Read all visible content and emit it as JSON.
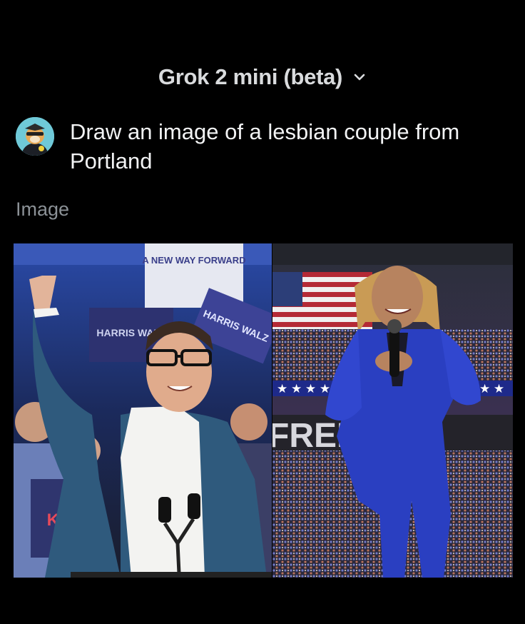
{
  "header": {
    "model_title": "Grok 2 mini (beta)",
    "dropdown_icon": "chevron-down-icon"
  },
  "conversation": {
    "user_avatar_icon": "dog-avatar-icon",
    "prompt_text": "Draw an image of a lesbian couple from Portland",
    "response_label": "Image"
  },
  "image": {
    "left_signs": [
      "A NEW WAY FORWARD",
      "HARRIS WALZ",
      "HARRIS WALZ",
      "KA"
    ],
    "right_banner_text": "FREEDOM"
  },
  "colors": {
    "background": "#000000",
    "title": "#d9dbdd",
    "label_gray": "#8b9196",
    "suit_blue": "#2a3fc1",
    "jacket_teal": "#2f5a7d"
  }
}
